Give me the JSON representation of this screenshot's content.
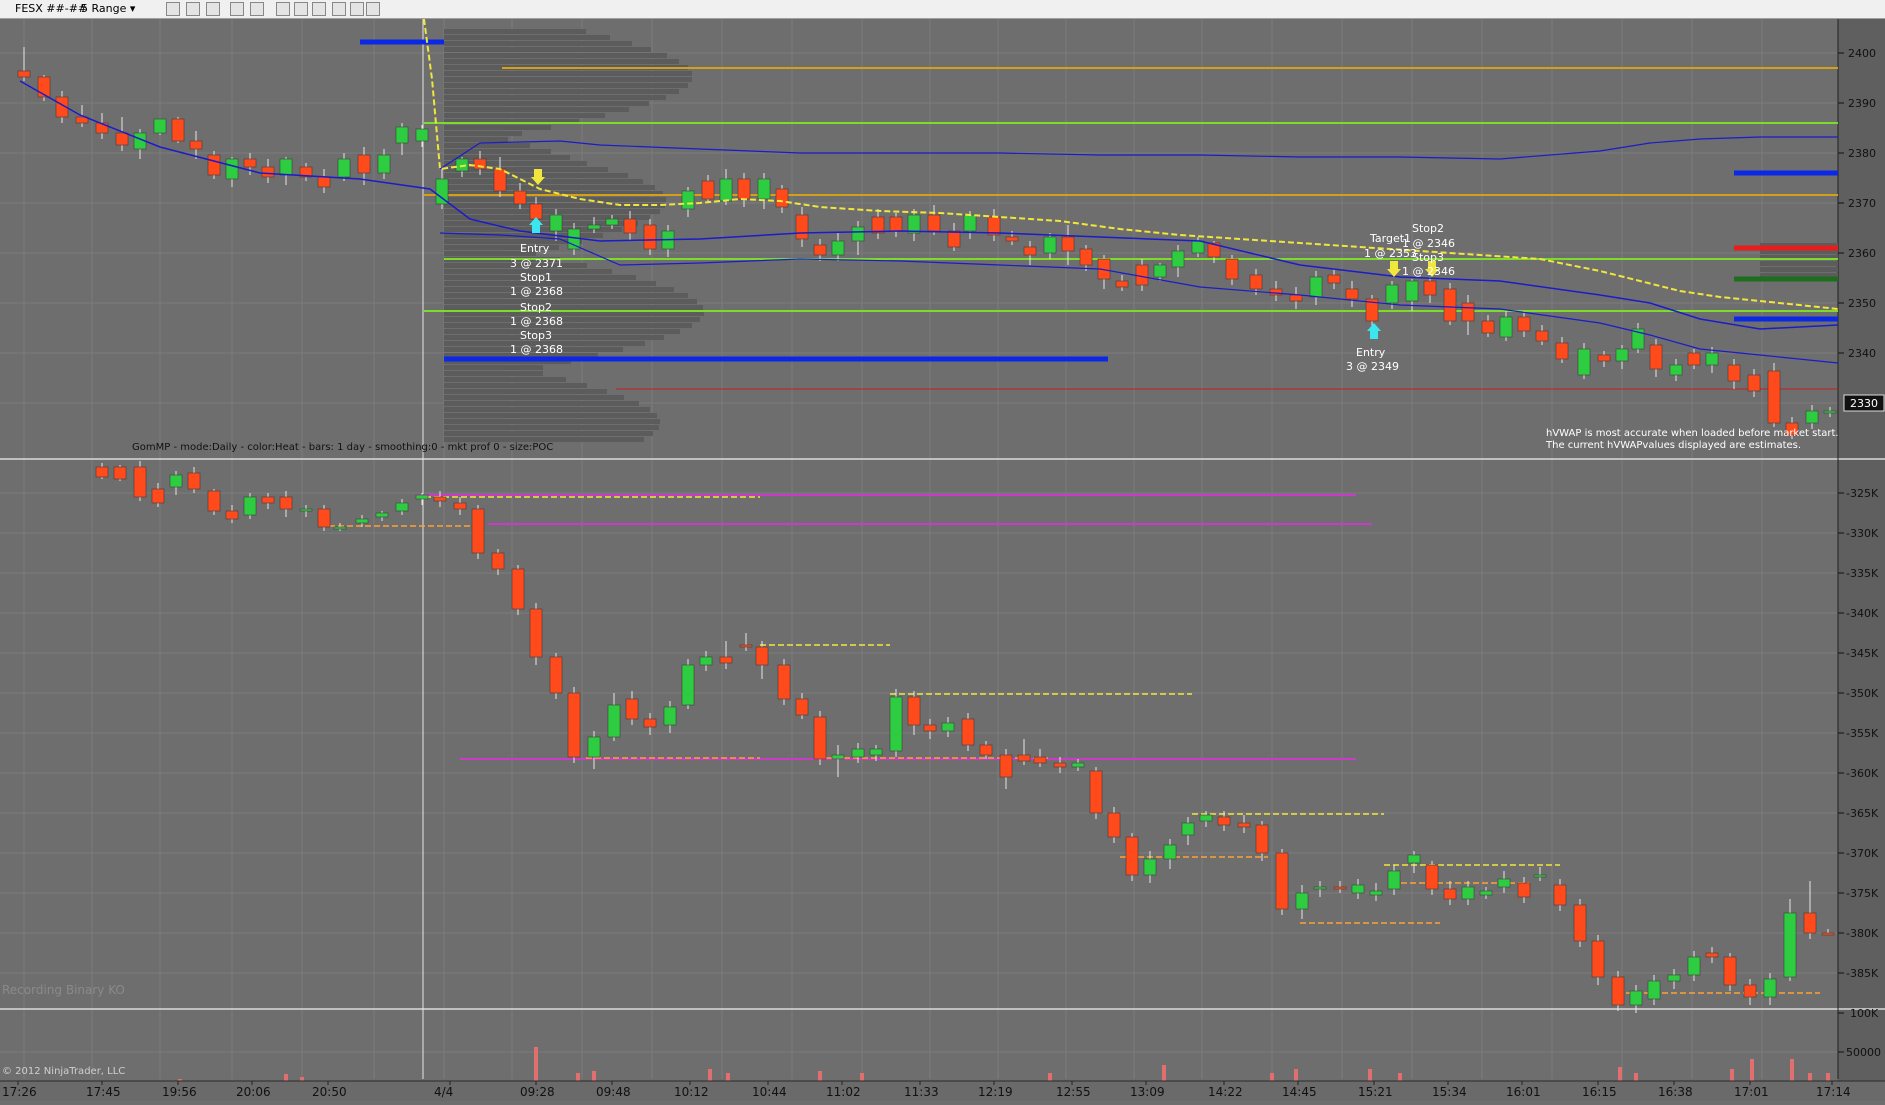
{
  "toolbar": {
    "instrument": "FESX ##-##",
    "instrument_arrow": "▾",
    "period": "5 Range",
    "period_arrow": "▾",
    "icons": [
      "bar-style-icon",
      "pencil-draw-icon",
      "zoom-in-icon",
      "zoom-out-icon",
      "crosshair-icon",
      "properties-icon",
      "data-box-icon",
      "strategies-icon",
      "chart-trader-icon",
      "dollar-icon",
      "instrument-list-icon"
    ]
  },
  "colors": {
    "background": "#6e6e6e",
    "up_candle": "#2ecc40",
    "down_candle": "#ff4a1c",
    "vwap": "#1c1cc8",
    "yellow_dashed": "#f0e63c",
    "green_level": "#7ddc2a",
    "orange_level": "#d4a017",
    "blue_level": "#0a28e6",
    "magenta_level": "#c83cc8",
    "red_level": "#c81e1e"
  },
  "price_axis": {
    "labels": [
      "2400",
      "2390",
      "2380",
      "2370",
      "2360",
      "2350",
      "2340"
    ],
    "last_price": "2330"
  },
  "delta_axis": {
    "labels": [
      "-325K",
      "-330K",
      "-335K",
      "-340K",
      "-345K",
      "-350K",
      "-355K",
      "-360K",
      "-365K",
      "-370K",
      "-375K",
      "-380K",
      "-385K"
    ]
  },
  "volume_axis": {
    "labels": [
      "100K",
      "50000"
    ]
  },
  "time_axis": {
    "labels": [
      "17:26",
      "17:45",
      "19:56",
      "20:06",
      "20:50",
      "4/4",
      "09:28",
      "09:48",
      "10:12",
      "10:44",
      "11:02",
      "11:33",
      "12:19",
      "12:55",
      "13:09",
      "14:22",
      "14:45",
      "15:21",
      "15:34",
      "16:01",
      "16:15",
      "16:38",
      "17:01",
      "17:14"
    ]
  },
  "annotations": {
    "entry1": {
      "l1": "Entry",
      "l2": "3 @ 2371"
    },
    "stop1": {
      "l1": "Stop1",
      "l2": "1 @ 2368"
    },
    "stop2a": {
      "l1": "Stop2",
      "l2": "1 @ 2368"
    },
    "stop3a": {
      "l1": "Stop3",
      "l2": "1 @ 2368"
    },
    "target": {
      "l1": "Target1",
      "l2": "1 @ 2353"
    },
    "stop2b": {
      "l1": "Stop2",
      "l2": "1 @ 2346"
    },
    "stop3b": {
      "l1": "Stop3",
      "l2": "1 @ 2346"
    },
    "entry2": {
      "l1": "Entry",
      "l2": "3 @ 2349"
    }
  },
  "indicator_label": "GomMP - mode:Daily - color:Heat - bars: 1 day - smoothing:0 - mkt prof 0 - size:POC",
  "hvwap_note": {
    "line1": "hVWAP is most accurate when loaded before market start.",
    "line2": "The current hVWAPvalues displayed are estimates."
  },
  "recording_label": "Recording Binary KO",
  "copyright": "© 2012 NinjaTrader, LLC"
}
